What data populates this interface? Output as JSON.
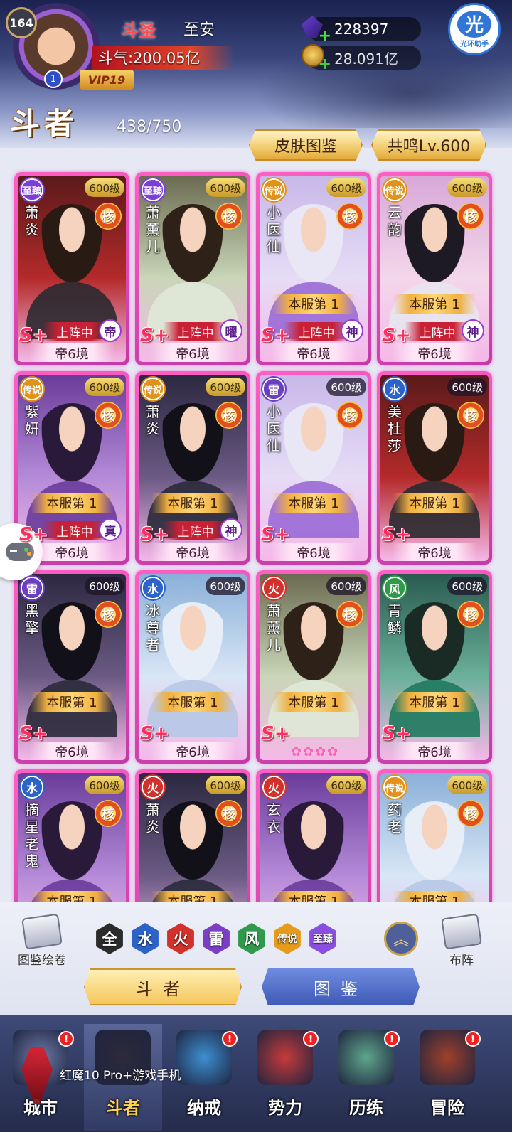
{
  "header": {
    "player_level": "164",
    "rank_index": "1",
    "vip": "VIP19",
    "title_rank": "斗圣",
    "player_name": "至安",
    "power": "斗气:200.05亿",
    "gems": "228397",
    "coins": "28.091亿",
    "helper_glyph": "光",
    "helper_label": "光环助手",
    "page_title": "斗者",
    "fighter_count": "438/750",
    "skin_button": "皮肤图鉴",
    "resonance_button": "共鸣Lv.600"
  },
  "cards": [
    {
      "name": "萧炎",
      "tag": "至臻",
      "level": "600级",
      "level_gold": true,
      "core": "核",
      "server": "",
      "deployed": "上阵中",
      "god": "帝",
      "realm": "帝6境",
      "grade": "S+",
      "palette": "red"
    },
    {
      "name": "萧薰儿",
      "tag": "至臻",
      "level": "600级",
      "level_gold": true,
      "core": "核",
      "server": "",
      "deployed": "上阵中",
      "god": "曜",
      "realm": "帝6境",
      "grade": "S+",
      "palette": "green"
    },
    {
      "name": "小医仙",
      "tag": "传说",
      "level": "600级",
      "level_gold": true,
      "core": "核",
      "server": "本服第 1",
      "deployed": "上阵中",
      "god": "神",
      "realm": "帝6境",
      "grade": "S+",
      "palette": "white"
    },
    {
      "name": "云韵",
      "tag": "传说",
      "level": "600级",
      "level_gold": true,
      "core": "核",
      "server": "本服第 1",
      "deployed": "上阵中",
      "god": "神",
      "realm": "帝6境",
      "grade": "S+",
      "palette": "pink"
    },
    {
      "name": "紫妍",
      "tag": "传说",
      "level": "600级",
      "level_gold": true,
      "core": "核",
      "server": "本服第 1",
      "deployed": "上阵中",
      "god": "真",
      "realm": "帝6境",
      "grade": "S+",
      "palette": "purple"
    },
    {
      "name": "萧炎",
      "tag": "传说",
      "level": "600级",
      "level_gold": true,
      "core": "核",
      "server": "本服第 1",
      "deployed": "上阵中",
      "god": "神",
      "realm": "帝6境",
      "grade": "S+",
      "palette": "dark"
    },
    {
      "name": "小医仙",
      "tag": "雷",
      "level": "600级",
      "level_gold": false,
      "core": "核",
      "server": "本服第 1",
      "deployed": "",
      "god": "",
      "realm": "帝6境",
      "grade": "S+",
      "palette": "white"
    },
    {
      "name": "美杜莎",
      "tag": "水",
      "level": "600级",
      "level_gold": false,
      "core": "核",
      "server": "本服第 1",
      "deployed": "",
      "god": "",
      "realm": "帝6境",
      "grade": "S+",
      "palette": "red"
    },
    {
      "name": "黑擎",
      "tag": "雷",
      "level": "600级",
      "level_gold": false,
      "core": "核",
      "server": "本服第 1",
      "deployed": "",
      "god": "",
      "realm": "帝6境",
      "grade": "S+",
      "palette": "dark"
    },
    {
      "name": "冰尊者",
      "tag": "水",
      "level": "600级",
      "level_gold": false,
      "core": "",
      "server": "本服第 1",
      "deployed": "",
      "god": "",
      "realm": "帝6境",
      "grade": "S+",
      "palette": "ice"
    },
    {
      "name": "萧薰儿",
      "tag": "火",
      "level": "600级",
      "level_gold": false,
      "core": "核",
      "server": "本服第 1",
      "deployed": "",
      "god": "",
      "realm": "",
      "lotus": "✿✿✿✿",
      "grade": "S+",
      "palette": "green"
    },
    {
      "name": "青鳞",
      "tag": "风",
      "level": "600级",
      "level_gold": false,
      "core": "核",
      "server": "本服第 1",
      "deployed": "",
      "god": "",
      "realm": "帝6境",
      "grade": "S+",
      "palette": "teal"
    },
    {
      "name": "摘星老鬼",
      "tag": "水",
      "level": "600级",
      "level_gold": true,
      "core": "核",
      "server": "本服第 1",
      "deployed": "",
      "god": "",
      "realm": "",
      "grade": "",
      "palette": "purple"
    },
    {
      "name": "萧炎",
      "tag": "火",
      "level": "600级",
      "level_gold": true,
      "core": "核",
      "server": "本服第 1",
      "deployed": "",
      "god": "",
      "realm": "",
      "grade": "",
      "palette": "dark"
    },
    {
      "name": "玄衣",
      "tag": "火",
      "level": "600级",
      "level_gold": true,
      "core": "",
      "server": "本服第 1",
      "deployed": "",
      "god": "",
      "realm": "",
      "grade": "",
      "palette": "purple"
    },
    {
      "name": "药老",
      "tag": "传说",
      "level": "600级",
      "level_gold": true,
      "core": "核",
      "server": "本服第 1",
      "deployed": "",
      "god": "",
      "realm": "",
      "grade": "",
      "palette": "ice"
    }
  ],
  "filters": {
    "atlas_label": "图鉴绘卷",
    "formation_label": "布阵",
    "expand_icon": "chevron-up-icon",
    "elements": [
      {
        "label": "全",
        "color": "#2b2b2b",
        "border": "#e6c15a"
      },
      {
        "label": "水",
        "color": "#2c63c8"
      },
      {
        "label": "火",
        "color": "#d2322b"
      },
      {
        "label": "雷",
        "color": "#7a3fc4"
      },
      {
        "label": "风",
        "color": "#2f9a4a"
      },
      {
        "label": "传说",
        "color": "#e69b1a"
      },
      {
        "label": "至臻",
        "color": "#8a4fe0"
      }
    ],
    "fighter_tab": "斗者",
    "atlas_tab": "图鉴"
  },
  "nav": [
    {
      "label": "城市",
      "badge": "!",
      "color": "#6c7aa8"
    },
    {
      "label": "斗者",
      "badge": "",
      "color": "#2d2a3a",
      "active": true
    },
    {
      "label": "纳戒",
      "badge": "!",
      "color": "#3d8fd1"
    },
    {
      "label": "势力",
      "badge": "!",
      "color": "#c83a3a"
    },
    {
      "label": "历练",
      "badge": "!",
      "color": "#5fa68a"
    },
    {
      "label": "冒险",
      "badge": "!",
      "color": "#a0402a"
    }
  ],
  "watermark": "红魔10 Pro+游戏手机"
}
